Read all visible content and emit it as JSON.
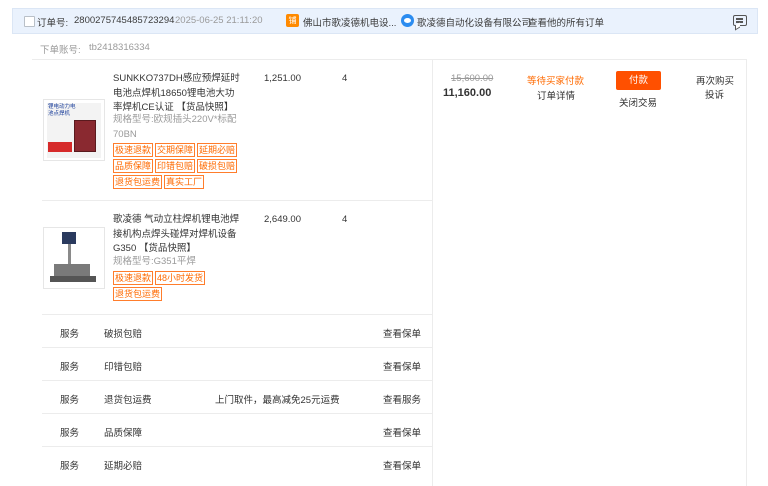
{
  "header": {
    "order_label": "订单号:",
    "order_number": "2800275745485723294",
    "order_time": "2025-06-25 21:11:20",
    "shop_name": "佛山市歌凌德机电设...",
    "shop_icon_text": "铺",
    "seller_name": "歌凌德自动化设备有限公司",
    "view_all_orders": "查看他的所有订单"
  },
  "sub_account": {
    "label": "下单账号:",
    "value": "tb2418316334"
  },
  "products": [
    {
      "title": "SUNKKO737DH感应预焊延时电池点焊机18650锂电池大功率焊机CE认证 【货品快照】",
      "spec": "规格型号:欧规插头220V*标配70BN",
      "unit_price": "1,251.00",
      "quantity": "4",
      "tags": [
        "极速退款",
        "交期保障",
        "延期必赔",
        "品质保障",
        "印错包赔",
        "破损包赔",
        "退货包运费",
        "真实工厂"
      ],
      "thumb_text": "锂电动力电池点焊机"
    },
    {
      "title": "歌凌德 气动立柱焊机锂电池焊接机构点焊头碰焊对焊机设备G350 【货品快照】",
      "spec": "规格型号:G351平焊",
      "unit_price": "2,649.00",
      "quantity": "4",
      "tags": [
        "极速退款",
        "48小时发货",
        "退货包运费"
      ]
    }
  ],
  "totals": {
    "original": "15,600.00",
    "actual": "11,160.00"
  },
  "status": {
    "state": "等待买家付款",
    "detail": "订单详情"
  },
  "actions": {
    "pay": "付款",
    "close": "关闭交易",
    "rebuy": "再次购买",
    "complain": "投诉"
  },
  "services": [
    {
      "type": "服务",
      "name": "破损包赔",
      "note": "",
      "action": "查看保单"
    },
    {
      "type": "服务",
      "name": "印错包赔",
      "note": "",
      "action": "查看保单"
    },
    {
      "type": "服务",
      "name": "退货包运费",
      "note": "上门取件，最高减免25元运费",
      "action": "查看服务"
    },
    {
      "type": "服务",
      "name": "品质保障",
      "note": "",
      "action": "查看保单"
    },
    {
      "type": "服务",
      "name": "延期必赔",
      "note": "",
      "action": "查看保单"
    }
  ],
  "colors": {
    "accent": "#ff5000",
    "header_bg": "#eaf2fd",
    "tag_orange": "#ff6a00"
  }
}
